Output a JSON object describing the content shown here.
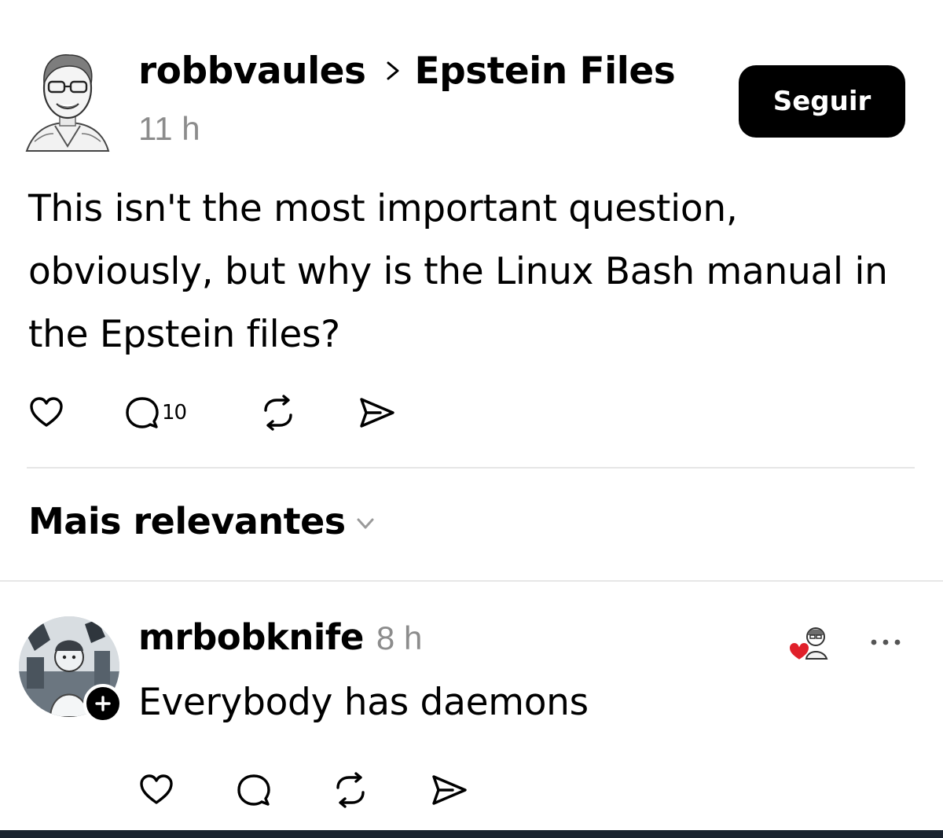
{
  "post": {
    "username": "robbvaules",
    "topic": "Epstein Files",
    "time": "11 h",
    "follow_label": "Seguir",
    "text": "This isn't the most important question, obviously, but why is the Linux Bash manual in the Epstein files?",
    "actions": {
      "like_icon": "heart-icon",
      "comment_icon": "comment-icon",
      "comment_count": "10",
      "repost_icon": "repost-icon",
      "share_icon": "send-icon"
    }
  },
  "sort": {
    "label": "Mais relevantes",
    "icon": "chevron-down-icon"
  },
  "reply": {
    "username": "mrbobknife",
    "time": "8 h",
    "text": "Everybody has daemons",
    "liked_badge_color": "#e0202a"
  },
  "colors": {
    "text": "#000000",
    "muted": "#8c8c8c",
    "divider": "#e6e6e6",
    "button_bg": "#000000",
    "button_text": "#ffffff"
  }
}
